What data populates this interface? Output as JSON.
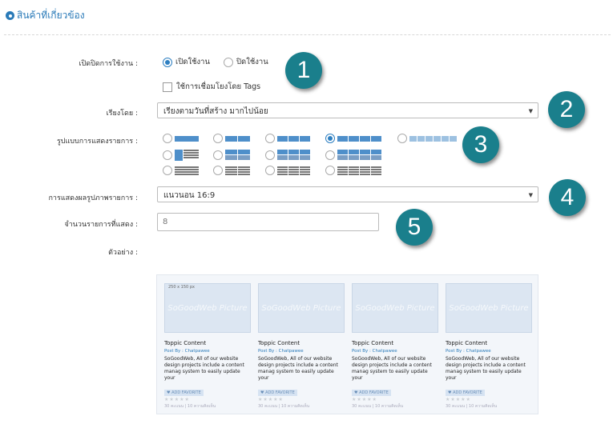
{
  "header": {
    "title": "สินค้าที่เกี่ยวข้อง",
    "icon": "gear-icon"
  },
  "form": {
    "enable": {
      "label": "เปิดปิดการใช้งาน :",
      "on": "เปิดใช้งาน",
      "off": "ปิดใช้งาน",
      "selected": "on"
    },
    "tags": {
      "label": "ใช้การเชื่อมโยงโดย Tags",
      "checked": false
    },
    "sort": {
      "label": "เรียงโดย :",
      "value": "เรียงตามวันที่สร้าง มากไปน้อย"
    },
    "layout": {
      "label": "รูปแบบการแสดงรายการ :",
      "selected": "row1-col4"
    },
    "ratio": {
      "label": "การแสดงผลรูปภาพรายการ :",
      "value": "แนวนอน 16:9"
    },
    "count": {
      "label": "จำนวนรายการที่แสดง :",
      "value": "8"
    },
    "example": {
      "label": "ตัวอย่าง :"
    }
  },
  "badges": [
    "1",
    "2",
    "3",
    "4",
    "5"
  ],
  "preview": {
    "dim_label": "250 x 150 px",
    "watermark": "SoGoodWeb Picture",
    "cards": [
      {
        "title": "Toppic Content",
        "post": "Post By : Chatpawee",
        "desc": "SoGoodWeb, All of our website design projects include a content manag system to easily update your",
        "fav": "ADD FAVORITE",
        "stats": "30 คะแนน | 10 ความคิดเห็น"
      },
      {
        "title": "Toppic Content",
        "post": "Post By : Chatpawee",
        "desc": "SoGoodWeb, All of our website design projects include a content manag system to easily update your",
        "fav": "ADD FAVORITE",
        "stats": "30 คะแนน | 10 ความคิดเห็น"
      },
      {
        "title": "Toppic Content",
        "post": "Post By : Chatpawee",
        "desc": "SoGoodWeb, All of our website design projects include a content manag system to easily update your",
        "fav": "ADD FAVORITE",
        "stats": "30 คะแนน | 10 ความคิดเห็น"
      },
      {
        "title": "Toppic Content",
        "post": "Post By : Chatpawee",
        "desc": "SoGoodWeb, All of our website design projects include a content manag system to easily update your",
        "fav": "ADD FAVORITE",
        "stats": "30 คะแนน | 10 ความคิดเห็น"
      }
    ]
  },
  "colors": {
    "accent": "#2a7ab8",
    "badge": "#1a7f8c",
    "layout_icon": "#4e8fca"
  }
}
